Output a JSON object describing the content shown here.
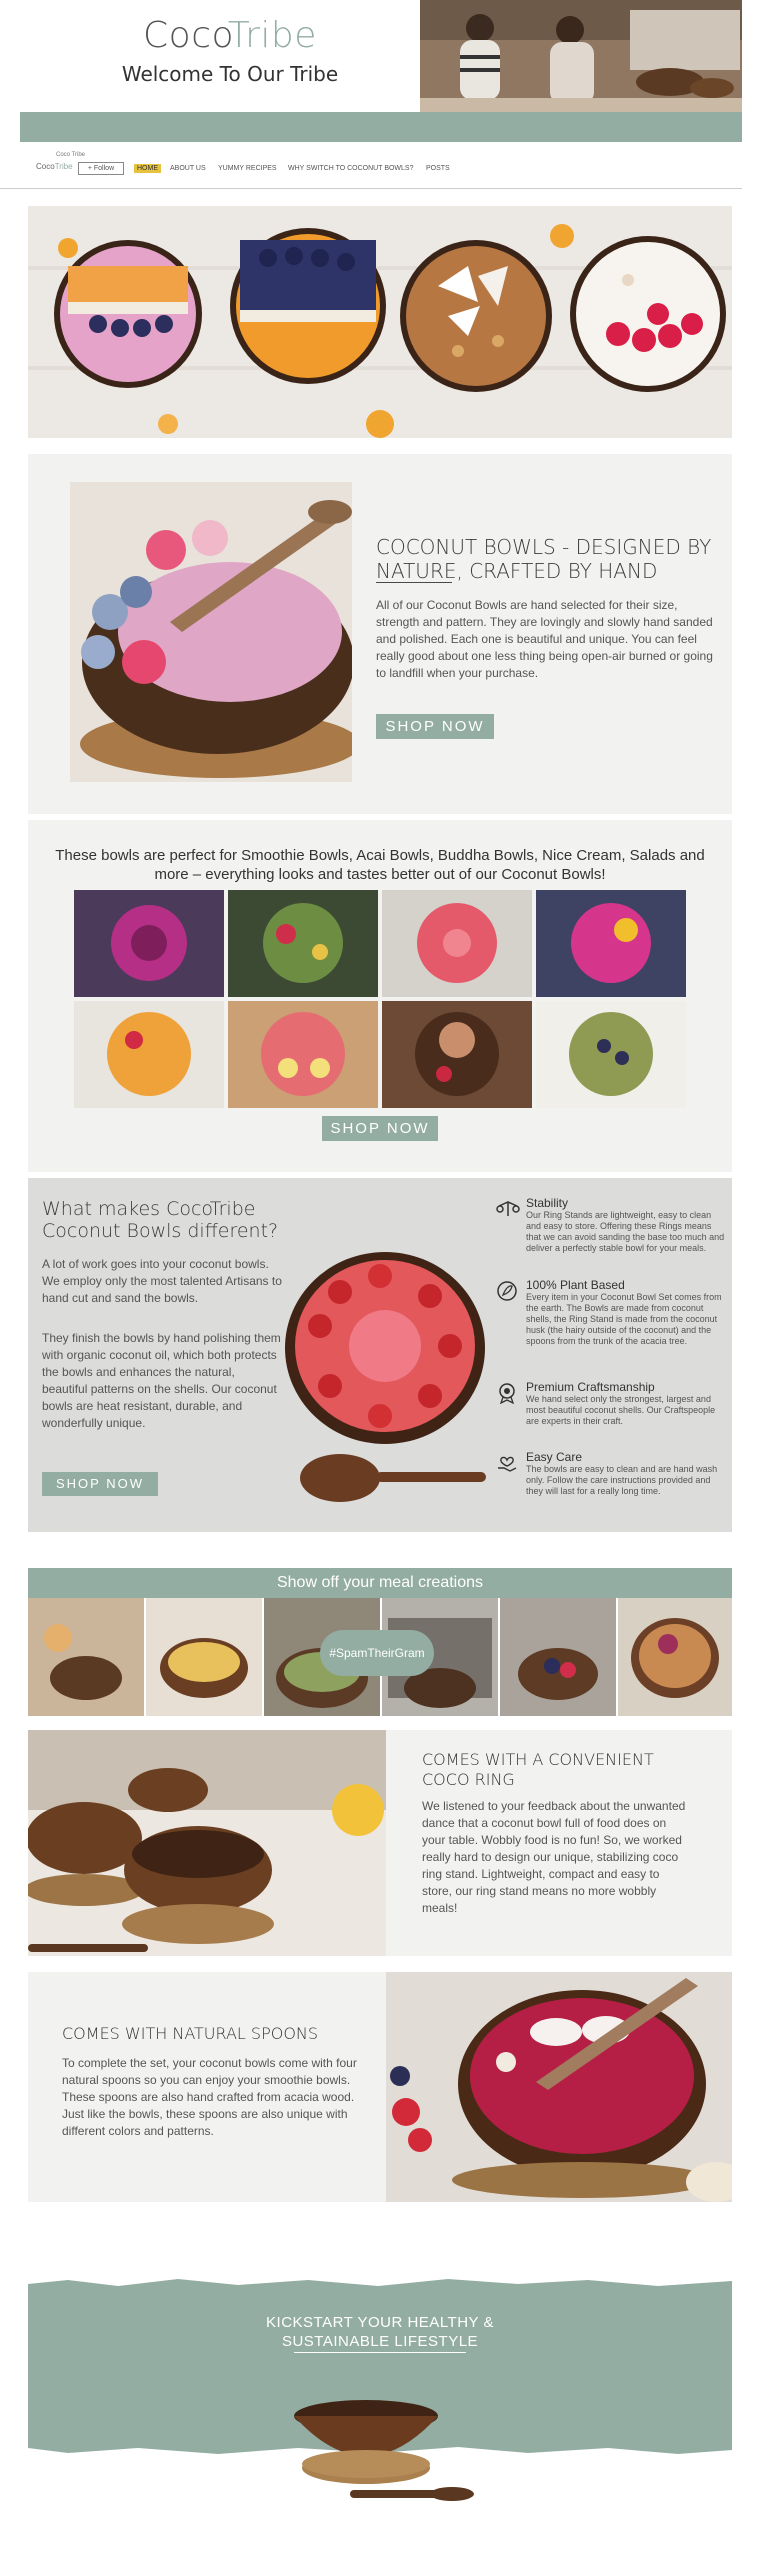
{
  "header": {
    "logo_left": "Coco",
    "logo_right": "Tribe",
    "tagline": "Welcome To Our Tribe"
  },
  "nav": {
    "brand_small": "Coco Tribe",
    "brand_logo_left": "Coco",
    "brand_logo_right": "Tribe",
    "follow_label": "+ Follow",
    "items": [
      "HOME",
      "ABOUT US",
      "YUMMY RECIPES",
      "WHY SWITCH TO COCONUT BOWLS?",
      "POSTS"
    ]
  },
  "intro": {
    "heading": "COCONUT BOWLS - DESIGNED BY NATURE, CRAFTED BY HAND",
    "body": "All of our Coconut Bowls are hand selected for their size, strength and pattern. They are lovingly and slowly hand sanded and polished. Each one is beautiful and unique. You can feel really good about one less thing being open-air burned or going to landfill when your purchase.",
    "button": "SHOP NOW"
  },
  "perfect_for": {
    "heading": "These bowls are perfect for Smoothie Bowls, Acai Bowls, Buddha Bowls, Nice Cream, Salads and more – everything looks and tastes better out of our Coconut Bowls!",
    "button": "SHOP NOW"
  },
  "different": {
    "heading": "What makes CocoTribe Coconut Bowls different?",
    "para1": "A lot of work goes into your coconut bowls. We employ only the most talented Artisans to hand cut and sand the bowls.",
    "para2": "They finish the bowls by hand polishing them with organic coconut oil, which both protects the bowls and enhances the natural, beautiful patterns on the shells. Our coconut bowls are heat resistant, durable, and wonderfully unique.",
    "button": "SHOP NOW",
    "features": [
      {
        "icon": "balance-stand-icon",
        "title": "Stability",
        "text": "Our Ring Stands are lightweight, easy to clean and easy to store. Offering these Rings means that we can avoid sanding the base too much and deliver a perfectly stable bowl for your meals."
      },
      {
        "icon": "leaf-icon",
        "title": "100% Plant Based",
        "text": "Every item in your Coconut Bowl Set comes from the earth. The Bowls are made from coconut shells, the Ring Stand is made from the coconut husk (the hairy outside of the coconut) and the spoons from the trunk of the acacia tree."
      },
      {
        "icon": "award-badge-icon",
        "title": "Premium Craftsmanship",
        "text": "We hand select only the strongest, largest and most beautiful coconut shells. Our Craftspeople are experts in their craft."
      },
      {
        "icon": "heart-hand-icon",
        "title": "Easy Care",
        "text": "The bowls are easy to clean and are hand wash only. Follow the care instructions provided and they will last for a really long time."
      }
    ]
  },
  "gallery": {
    "heading": "Show off your meal creations",
    "badge": "#SpamTheirGram"
  },
  "ring": {
    "heading": "COMES WITH A CONVENIENT COCO RING",
    "body": "We listened to your feedback about the unwanted dance that a coconut bowl full of food does on your table. Wobbly food is no fun! So, we worked really hard to design our unique, stabilizing coco ring stand. Lightweight, compact and easy to store, our ring stand means no more wobbly meals!"
  },
  "spoons": {
    "heading": "COMES WITH NATURAL SPOONS",
    "body": "To complete the set, your coconut bowls come with four natural spoons so you can enjoy your smoothie bowls. These spoons are also hand crafted from acacia wood. Just like the bowls, these spoons are also unique with different colors and patterns."
  },
  "kickstart": {
    "line1": "KICKSTART YOUR HEALTHY &",
    "line2": "SUSTAINABLE LIFESTYLE"
  },
  "colors": {
    "sage": "#93ada3",
    "nav_active": "#e7c23f",
    "text": "#4a4a4a",
    "section_grey": "#f2f2f1"
  }
}
